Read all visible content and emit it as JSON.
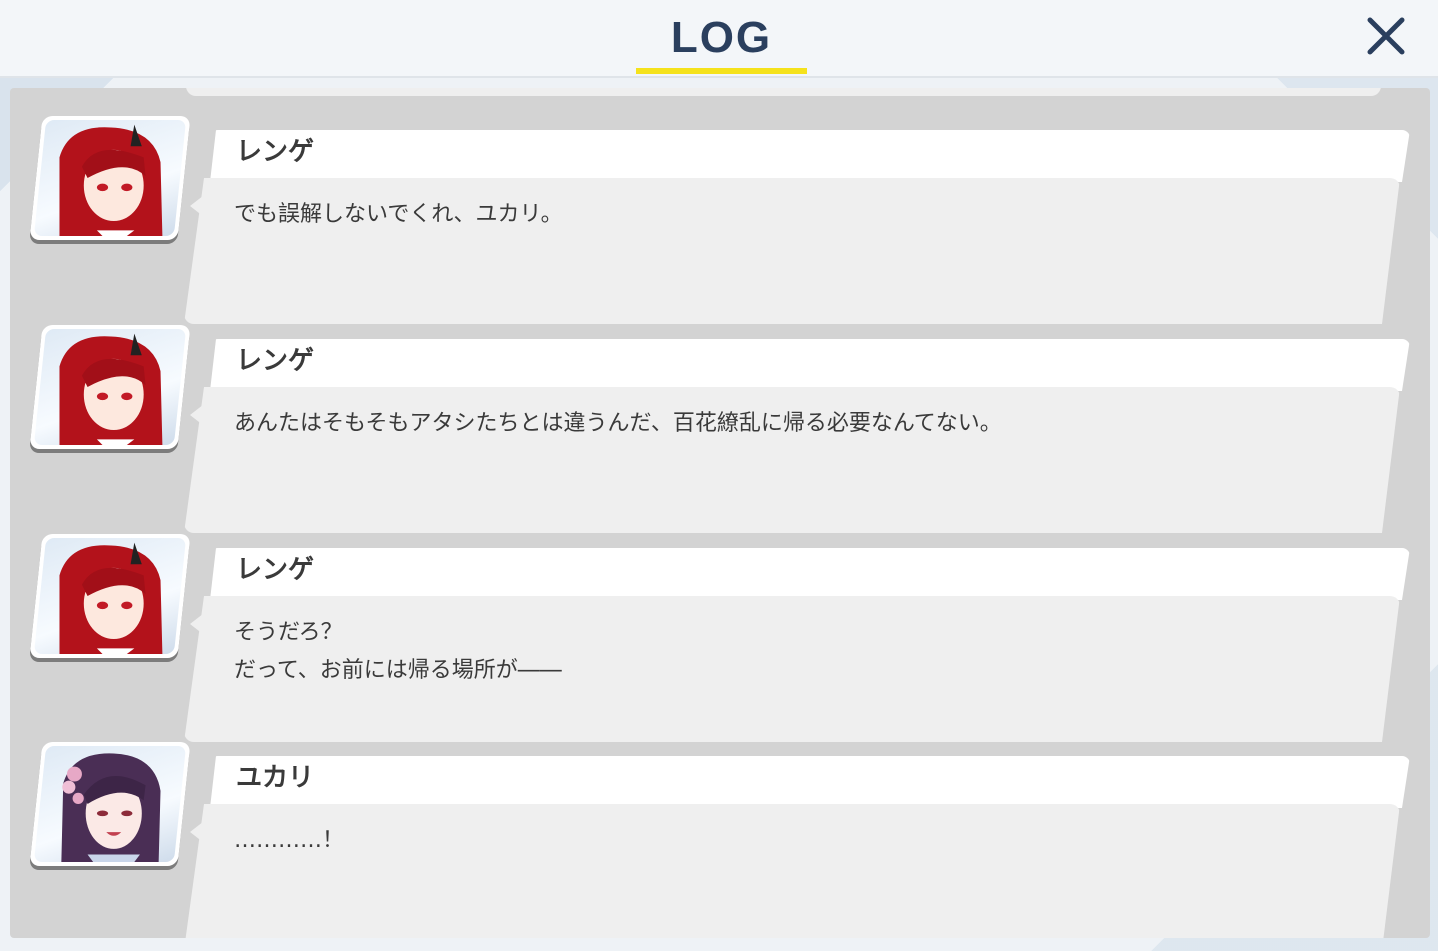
{
  "header": {
    "title": "LOG"
  },
  "entries": [
    {
      "speaker": "レンゲ",
      "text": "でも誤解しないでくれ、ユカリ。",
      "avatar": "renge-portrait"
    },
    {
      "speaker": "レンゲ",
      "text": "あんたはそもそもアタシたちとは違うんだ、百花繚乱に帰る必要なんてない。",
      "avatar": "renge-portrait"
    },
    {
      "speaker": "レンゲ",
      "text": "そうだろ？\nだって、お前には帰る場所が――",
      "avatar": "renge-portrait"
    },
    {
      "speaker": "ユカリ",
      "text": "…………！",
      "avatar": "yukari-portrait"
    }
  ],
  "colors": {
    "accent": "#f5e21c",
    "title": "#2a3f5e",
    "renge_hair": "#b3121b",
    "yukari_hair": "#4a2e55"
  }
}
